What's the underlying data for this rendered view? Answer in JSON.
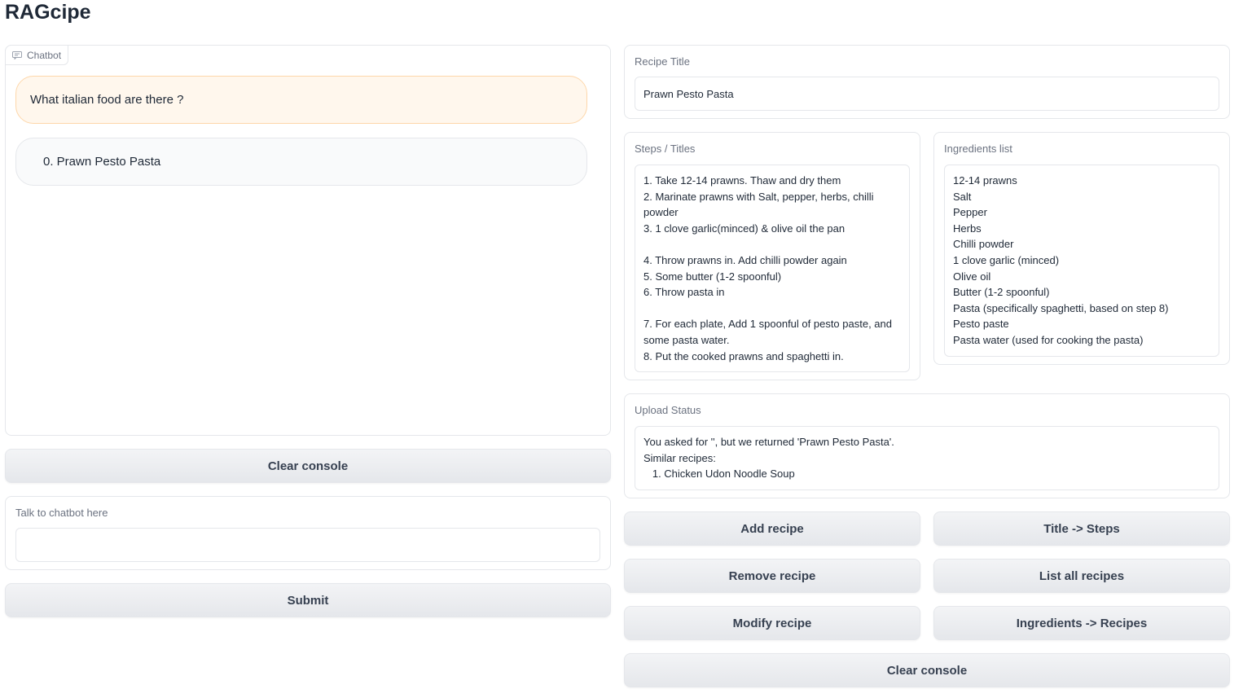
{
  "app": {
    "title": "RAGcipe"
  },
  "chatbot": {
    "label": "Chatbot",
    "messages": [
      {
        "role": "user",
        "text": "What italian food are there ?"
      },
      {
        "role": "bot",
        "text": "0. Prawn Pesto Pasta"
      }
    ],
    "clear_label": "Clear console"
  },
  "chat_input": {
    "label": "Talk to chatbot here",
    "value": "",
    "placeholder": "",
    "submit_label": "Submit"
  },
  "recipe_title": {
    "label": "Recipe Title",
    "value": "Prawn Pesto Pasta"
  },
  "steps": {
    "label": "Steps / Titles",
    "value": "1. Take 12-14 prawns. Thaw and dry them\n2. Marinate prawns with Salt, pepper, herbs, chilli powder\n3. 1 clove garlic(minced) & olive oil the pan\n\n4. Throw prawns in. Add chilli powder again\n5. Some butter (1-2 spoonful)\n6. Throw pasta in\n\n7. For each plate, Add 1 spoonful of pesto paste, and some pasta water.\n8. Put the cooked prawns and spaghetti in."
  },
  "ingredients": {
    "label": "Ingredients list",
    "value": "12-14 prawns\nSalt\nPepper\nHerbs\nChilli powder\n1 clove garlic (minced)\nOlive oil\nButter (1-2 spoonful)\nPasta (specifically spaghetti, based on step 8)\nPesto paste\nPasta water (used for cooking the pasta)"
  },
  "upload_status": {
    "label": "Upload Status",
    "value": "You asked for '', but we returned 'Prawn Pesto Pasta'.\nSimilar recipes:\n   1. Chicken Udon Noodle Soup"
  },
  "actions": {
    "add_recipe": "Add recipe",
    "title_to_steps": "Title -> Steps",
    "remove_recipe": "Remove recipe",
    "list_all_recipes": "List all recipes",
    "modify_recipe": "Modify recipe",
    "ingredients_to_recipes": "Ingredients -> Recipes",
    "clear_console": "Clear console"
  },
  "icons": {
    "chatbot_tag": "chat-bubble-icon"
  },
  "colors": {
    "user_bubble_bg": "#fff7ed",
    "user_bubble_border": "#fed7aa",
    "button_bg": "#e5e7eb",
    "border": "#e5e7eb"
  }
}
